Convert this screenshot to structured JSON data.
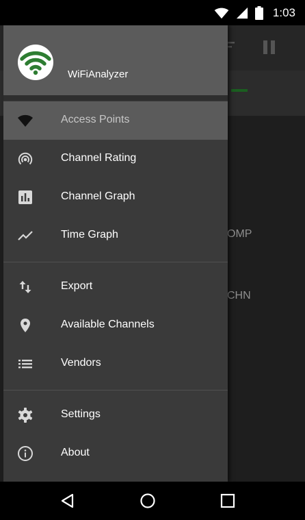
{
  "status_bar": {
    "time": "1:03"
  },
  "app_background": {
    "peek_labels": [
      "OMP",
      "CHN"
    ]
  },
  "drawer": {
    "app_name": "WiFiAnalyzer",
    "accent_color": "#2e7d32",
    "sections": [
      {
        "items": [
          {
            "label": "Access Points",
            "icon": "wifi-icon",
            "active": true
          },
          {
            "label": "Channel Rating",
            "icon": "wifi-tethering-icon"
          },
          {
            "label": "Channel Graph",
            "icon": "bar-chart-icon"
          },
          {
            "label": "Time Graph",
            "icon": "line-chart-icon"
          }
        ]
      },
      {
        "items": [
          {
            "label": "Export",
            "icon": "import-export-icon"
          },
          {
            "label": "Available Channels",
            "icon": "location-pin-icon"
          },
          {
            "label": "Vendors",
            "icon": "list-icon"
          }
        ]
      },
      {
        "items": [
          {
            "label": "Settings",
            "icon": "gear-icon"
          },
          {
            "label": "About",
            "icon": "info-icon"
          }
        ]
      }
    ]
  }
}
